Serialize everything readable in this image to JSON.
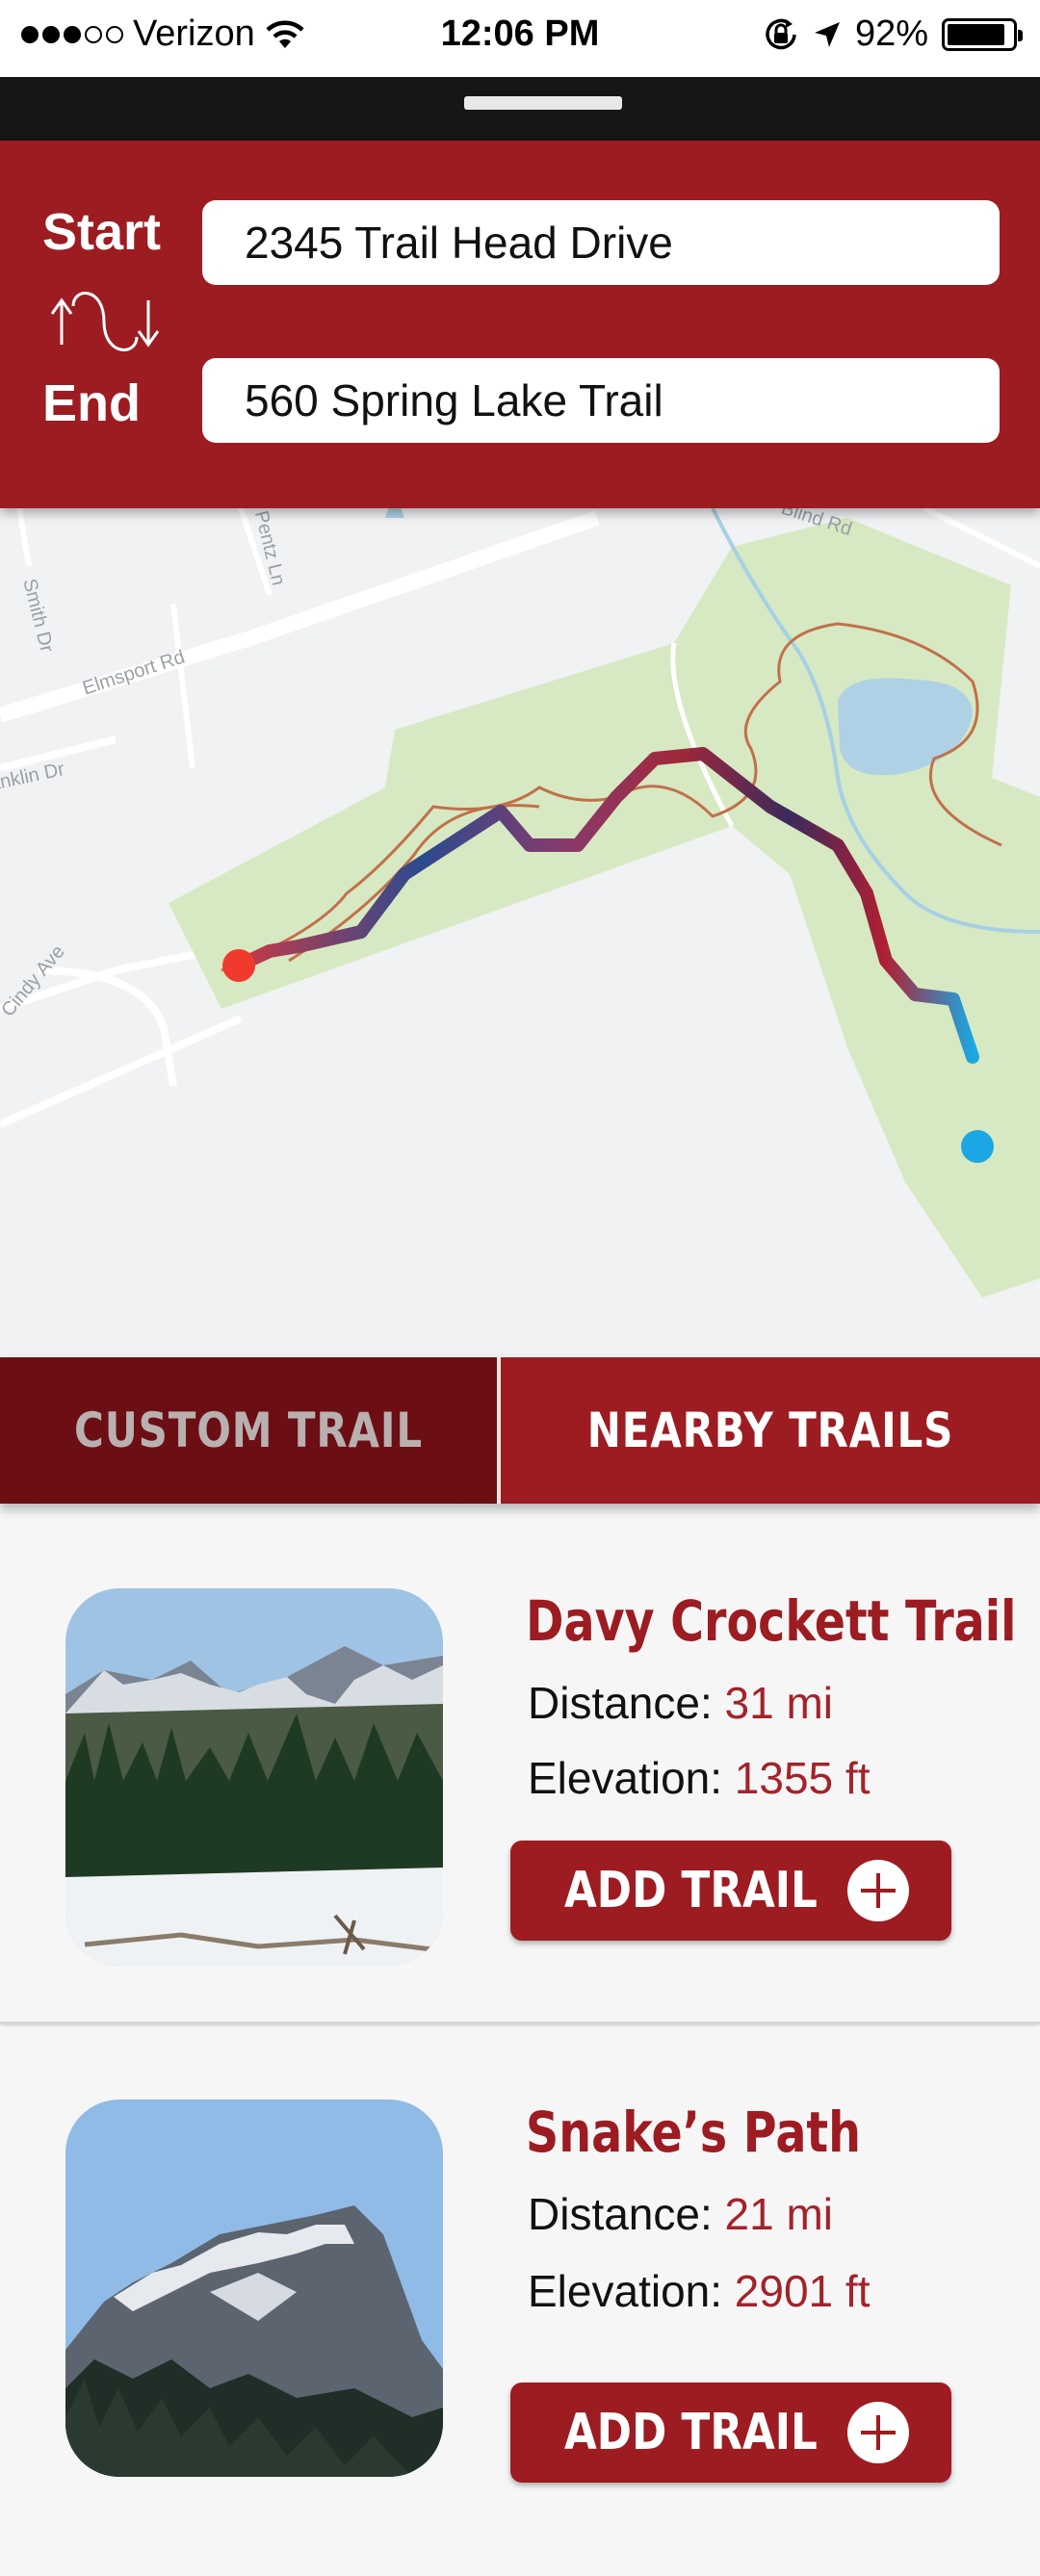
{
  "status_bar": {
    "carrier": "Verizon",
    "time": "12:06 PM",
    "battery": "92%",
    "signal_bars_filled": 3,
    "signal_bars_total": 5,
    "icons": [
      "wifi-icon",
      "rotation-lock-icon",
      "location-arrow-icon",
      "battery-icon"
    ]
  },
  "route": {
    "start_label": "Start",
    "end_label": "End",
    "start_value": "2345 Trail Head Drive",
    "end_value": "560 Spring Lake Trail",
    "swap_icon": "swap-route-icon"
  },
  "map": {
    "streets": [
      "Smith Dr",
      "Elmsport Rd",
      "Pentz Ln",
      "Franklin Dr",
      "Cindy Ave",
      "Blind Rd"
    ],
    "route_start_color": "#f03a2e",
    "route_end_color": "#1ba7e3",
    "park_color": "#d7e9c2",
    "lake_color": "#aed1e6"
  },
  "tabs": {
    "custom_label": "CUSTOM TRAIL",
    "nearby_label": "NEARBY TRAILS",
    "active": "NEARBY TRAILS"
  },
  "trails": [
    {
      "name": "Davy Crockett Trail",
      "distance_label": "Distance:",
      "distance": "31 mi",
      "elevation_label": "Elevation:",
      "elevation": "1355 ft",
      "button_label": "ADD TRAIL"
    },
    {
      "name": "Snake’s Path",
      "distance_label": "Distance:",
      "distance": "21 mi",
      "elevation_label": "Elevation:",
      "elevation": "2901 ft",
      "button_label": "ADD TRAIL"
    }
  ],
  "colors": {
    "brand_red": "#9c1c22",
    "dark_red": "#6b0f15",
    "value_red": "#a3232a"
  }
}
